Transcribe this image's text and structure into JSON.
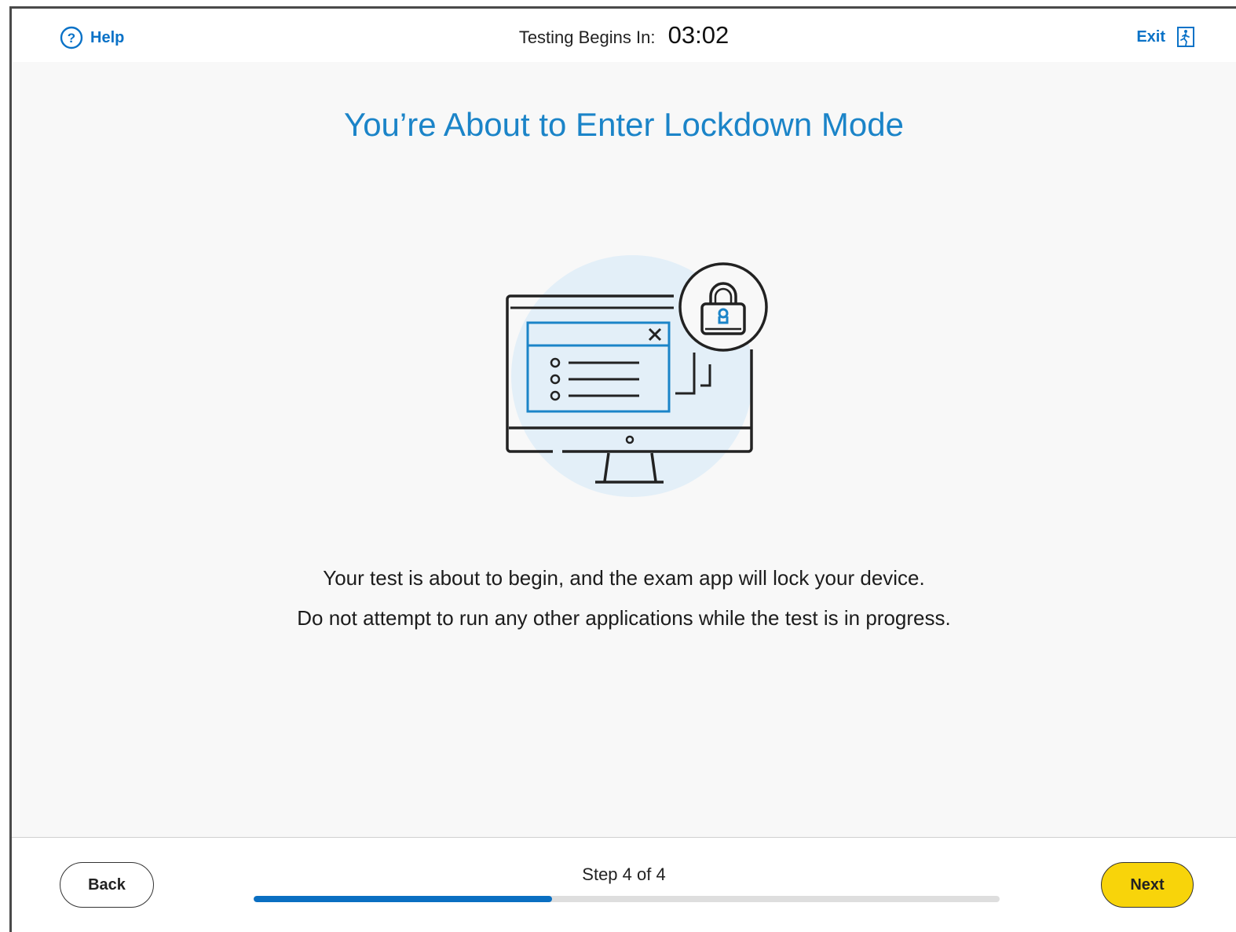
{
  "header": {
    "help_label": "Help",
    "help_icon": "help-circle-icon",
    "timer_label": "Testing Begins In:",
    "timer_value": "03:02",
    "exit_label": "Exit",
    "exit_icon": "exit-door-icon"
  },
  "main": {
    "title": "You’re About to Enter Lockdown Mode",
    "illustration_icon": "locked-computer-icon",
    "message_line1": "Your test is about to begin, and the exam app will lock your device.",
    "message_line2": "Do not attempt to run any other applications while the test is in progress."
  },
  "footer": {
    "back_label": "Back",
    "next_label": "Next",
    "step_label": "Step 4 of 4",
    "progress_fraction": 0.4
  },
  "colors": {
    "accent_blue": "#1b84c8",
    "link_blue": "#0a72c7",
    "progress_blue": "#0a6fc2",
    "next_yellow": "#f8d40a",
    "illustration_circle": "#e3eff8"
  }
}
